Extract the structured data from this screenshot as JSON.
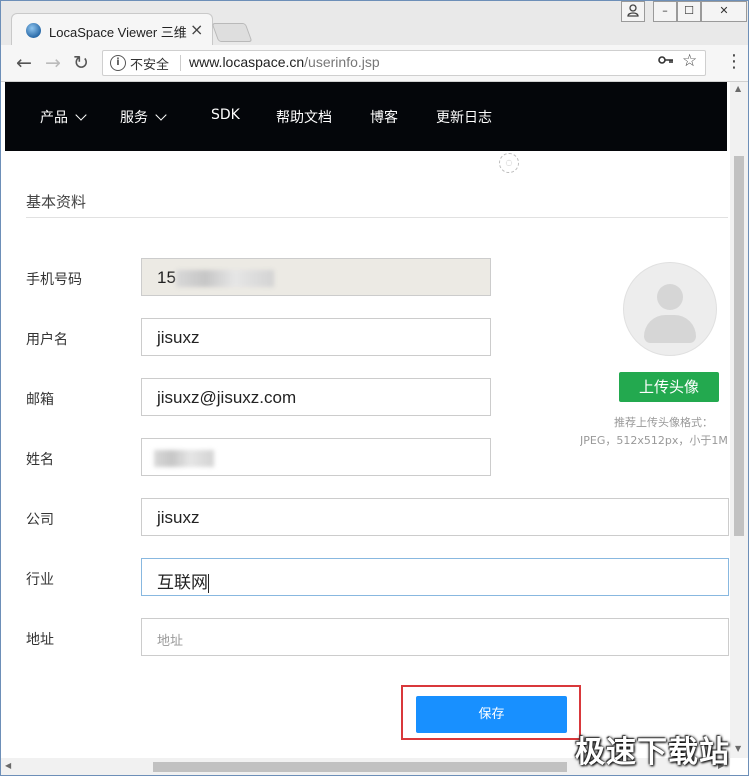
{
  "browser": {
    "tab_title": "LocaSpace Viewer 三维",
    "tab_close": "×",
    "window_controls": [
      "person",
      "–",
      "☐",
      "✕"
    ],
    "security_label": "不安全",
    "url_host": "www.locaspace.cn",
    "url_path": "/userinfo.jsp",
    "icons": [
      "back-arrow",
      "forward-arrow",
      "reload",
      "info",
      "key",
      "star",
      "menu"
    ]
  },
  "site_nav": {
    "items": [
      {
        "label": "产品",
        "has_dropdown": true
      },
      {
        "label": "服务",
        "has_dropdown": true
      },
      {
        "label": "SDK",
        "has_dropdown": false
      },
      {
        "label": "帮助文档",
        "has_dropdown": false
      },
      {
        "label": "博客",
        "has_dropdown": false
      },
      {
        "label": "更新日志",
        "has_dropdown": false
      }
    ]
  },
  "form": {
    "section_title": "基本资料",
    "fields": [
      {
        "label": "手机号码",
        "value": "15",
        "state": "disabled-partially-blurred"
      },
      {
        "label": "用户名",
        "value": "jisuxz"
      },
      {
        "label": "邮箱",
        "value": "jisuxz@jisuxz.com"
      },
      {
        "label": "姓名",
        "value": "",
        "state": "blurred"
      },
      {
        "label": "公司",
        "value": "jisuxz"
      },
      {
        "label": "行业",
        "value": "互联网",
        "state": "focused"
      },
      {
        "label": "地址",
        "value": "",
        "placeholder": "地址"
      }
    ],
    "save_label": "保存"
  },
  "avatar_panel": {
    "upload_label": "上传头像",
    "hint_line1": "推荐上传头像格式：",
    "hint_line2": "JPEG，512x512px，小于1M"
  },
  "watermark": "极速下载站",
  "colors": {
    "nav_bg": "#04060a",
    "upload_green": "#23a94f",
    "save_blue": "#1890ff",
    "highlight_red": "#d9383b"
  }
}
